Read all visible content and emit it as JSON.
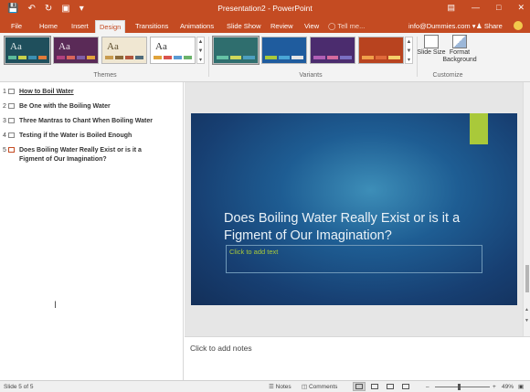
{
  "window": {
    "title": "Presentation2 - PowerPoint",
    "qat": [
      "save-icon",
      "undo-icon",
      "redo-icon",
      "start-from-beginning-icon",
      "customize-qat-icon"
    ],
    "controls": [
      "ribbon-display-options-icon",
      "minimize-icon",
      "maximize-icon",
      "close-icon"
    ]
  },
  "tabs": [
    {
      "label": "File",
      "active": false
    },
    {
      "label": "Home",
      "active": false
    },
    {
      "label": "Insert",
      "active": false
    },
    {
      "label": "Design",
      "active": true
    },
    {
      "label": "Transitions",
      "active": false
    },
    {
      "label": "Animations",
      "active": false
    },
    {
      "label": "Slide Show",
      "active": false
    },
    {
      "label": "Review",
      "active": false
    },
    {
      "label": "View",
      "active": false
    }
  ],
  "tellme": {
    "label": "Tell me..."
  },
  "account": {
    "label": "info@Dummies.com"
  },
  "share": {
    "label": "Share"
  },
  "ribbon": {
    "themes_label": "Themes",
    "variants_label": "Variants",
    "customize_label": "Customize",
    "theme_thumb_text": "Aa",
    "slide_size": "Slide Size",
    "format_background": "Format Background"
  },
  "outline": {
    "items": [
      {
        "num": "1",
        "text": "How to Boil Water"
      },
      {
        "num": "2",
        "text": "Be One with the Boiling Water"
      },
      {
        "num": "3",
        "text": "Three Mantras to Chant When Boiling Water"
      },
      {
        "num": "4",
        "text": "Testing if the Water is Boiled Enough"
      },
      {
        "num": "5",
        "text": "Does Boiling Water Really Exist or is it a Figment of Our Imagination?"
      }
    ]
  },
  "slide": {
    "title": "Does Boiling Water Really Exist or is it a Figment of Our Imagination?",
    "subtitle_placeholder": "Click to add text"
  },
  "notes": {
    "placeholder": "Click to add notes"
  },
  "status": {
    "slide_counter": "Slide 5 of 5",
    "notes_label": "Notes",
    "comments_label": "Comments",
    "zoom": "49%"
  },
  "colors": {
    "accent": "#c44b22",
    "slide_blue": "#1e5d93",
    "slide_lime": "#a9c93a"
  }
}
